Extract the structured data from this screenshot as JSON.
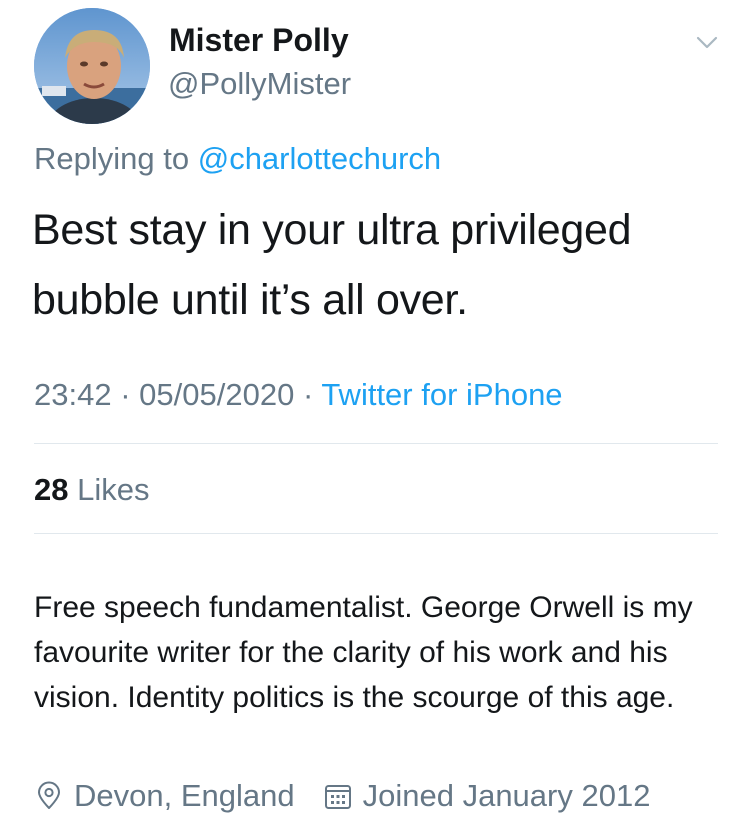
{
  "profile": {
    "name": "Mister Polly",
    "handle": "@PollyMister"
  },
  "tweet": {
    "reply_prefix": "Replying to",
    "reply_to": "@charlottechurch",
    "text": "Best stay in your ultra privileged bubble until it’s all over.",
    "time": "23:42",
    "separator": "·",
    "date": "05/05/2020",
    "source": "Twitter for iPhone",
    "likes_count": "28",
    "likes_label": "Likes"
  },
  "bio": {
    "text": "Free speech fundamentalist. George Orwell is my favourite writer for the clarity of his work and his vision. Identity politics is the scourge of this age.",
    "location": "Devon, England",
    "joined": "Joined January 2012"
  },
  "icons": {
    "menu": "chevron-down-icon",
    "location": "location-pin-icon",
    "joined": "calendar-icon"
  },
  "colors": {
    "link": "#1da1f2",
    "secondary_text": "#657786",
    "primary_text": "#14171a",
    "divider": "#e1e8ed"
  }
}
